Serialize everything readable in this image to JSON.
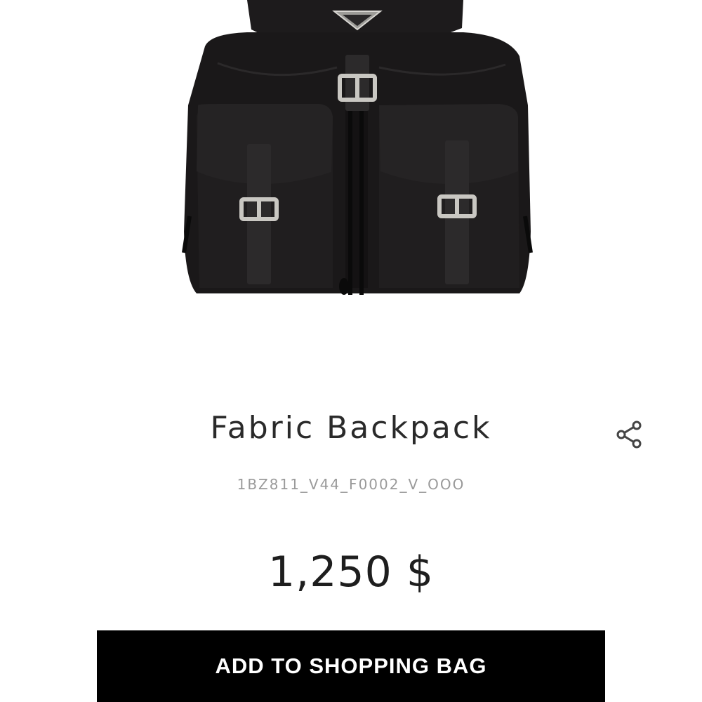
{
  "product": {
    "title": "Fabric Backpack",
    "sku": "1BZ811_V44_F0002_V_OOO",
    "price": "1,250 $"
  },
  "actions": {
    "add_to_bag_label": "ADD TO SHOPPING BAG",
    "share_icon": "share-icon"
  },
  "colors": {
    "button_bg": "#000000",
    "button_text": "#ffffff",
    "title_text": "#2a2a2a",
    "sku_text": "#9a9a9a"
  }
}
